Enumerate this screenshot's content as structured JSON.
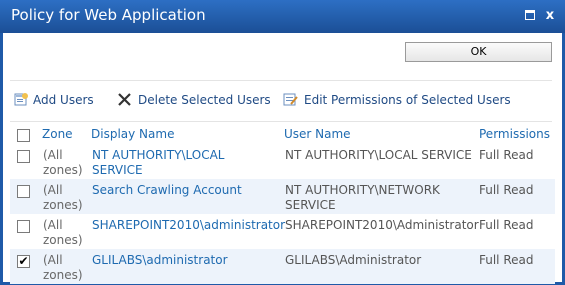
{
  "window": {
    "title": "Policy for Web Application",
    "close_glyph": "x"
  },
  "buttons": {
    "ok_label": "OK"
  },
  "toolbar": {
    "add_users": "Add Users",
    "delete_selected": "Delete Selected Users",
    "edit_permissions": "Edit Permissions of Selected Users"
  },
  "table": {
    "headers": {
      "zone": "Zone",
      "display_name": "Display Name",
      "user_name": "User Name",
      "permissions": "Permissions"
    },
    "rows": [
      {
        "checked": false,
        "zone": "(All zones)",
        "display_name": "NT AUTHORITY\\LOCAL SERVICE",
        "user_name": "NT AUTHORITY\\LOCAL SERVICE",
        "permissions": "Full Read"
      },
      {
        "checked": false,
        "zone": "(All zones)",
        "display_name": "Search Crawling Account",
        "user_name": "NT AUTHORITY\\NETWORK SERVICE",
        "permissions": "Full Read"
      },
      {
        "checked": false,
        "zone": "(All zones)",
        "display_name": "SHAREPOINT2010\\administrator",
        "user_name": "SHAREPOINT2010\\Administrator",
        "permissions": "Full Read"
      },
      {
        "checked": true,
        "zone": "(All zones)",
        "display_name": "GLILABS\\administrator",
        "user_name": "GLILABS\\Administrator",
        "permissions": "Full Read"
      }
    ]
  },
  "colors": {
    "title_bar": "#1f5aa8",
    "link": "#1e6ab0",
    "alt_row": "#edf3fb"
  },
  "icons": [
    "add-users-icon",
    "delete-x-icon",
    "edit-permissions-icon",
    "maximize-icon",
    "close-icon",
    "checkbox-icon"
  ]
}
